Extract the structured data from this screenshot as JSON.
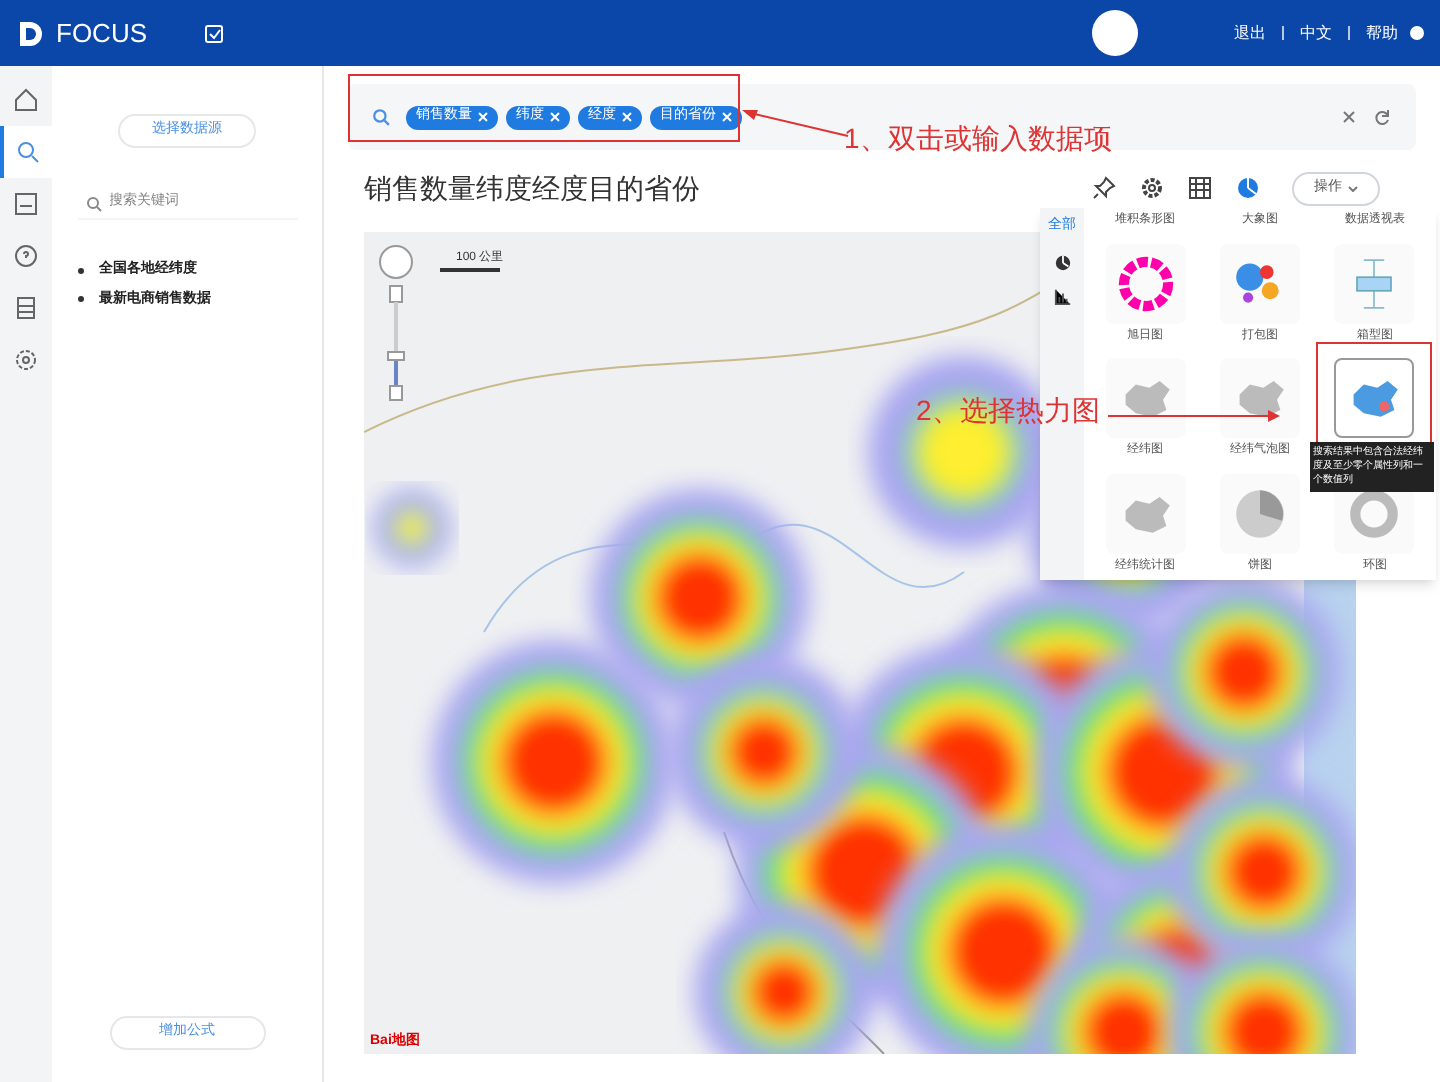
{
  "header": {
    "logo": "FOCUS",
    "links": [
      "退出",
      "中文",
      "帮助"
    ]
  },
  "nav": [
    {
      "kind": "home",
      "selected": false
    },
    {
      "kind": "search",
      "selected": true
    },
    {
      "kind": "board",
      "selected": false
    },
    {
      "kind": "help",
      "selected": false
    },
    {
      "kind": "db",
      "selected": false
    },
    {
      "kind": "gear",
      "selected": false
    }
  ],
  "left_panel": {
    "source_button": "选择数据源",
    "search": {
      "placeholder": "搜索关键词"
    },
    "sources": [
      "全国各地经纬度",
      "最新电商销售数据"
    ],
    "formula_button": "增加公式"
  },
  "search_bar": {
    "tokens": [
      "销售数量",
      "纬度",
      "经度",
      "目的省份"
    ]
  },
  "annotations": [
    "1、双击或输入数据项",
    "2、选择热力图"
  ],
  "title": "销售数量纬度经度目的省份",
  "operate_button": "操作",
  "map": {
    "scale": "100 公里",
    "logo": "Bai地图"
  },
  "chart_panel": {
    "tabs": [
      {
        "kind": "text",
        "label": "全部",
        "selected": true
      },
      {
        "kind": "pie",
        "selected": false
      },
      {
        "kind": "bars",
        "selected": false
      }
    ],
    "tiles": [
      {
        "kind": "none",
        "label": "堆积条形图",
        "selected": false
      },
      {
        "kind": "none",
        "label": "大象图",
        "selected": false
      },
      {
        "kind": "none",
        "label": "数据透视表",
        "selected": false
      },
      {
        "kind": "ring",
        "label": "旭日图",
        "selected": false
      },
      {
        "kind": "bubbles",
        "label": "打包图",
        "selected": false
      },
      {
        "kind": "box",
        "label": "箱型图",
        "selected": false
      },
      {
        "kind": "map",
        "label": "经纬图",
        "selected": false
      },
      {
        "kind": "map",
        "label": "经纬气泡图",
        "selected": false
      },
      {
        "kind": "heatmap",
        "selected": true,
        "tooltip": "搜索结果中包含合法经纬度及至少零个属性列和一个数值列"
      },
      {
        "kind": "map",
        "label": "经纬统计图",
        "selected": false
      },
      {
        "kind": "pie",
        "label": "饼图",
        "selected": false
      },
      {
        "kind": "donut",
        "label": "环图",
        "selected": false
      }
    ]
  }
}
